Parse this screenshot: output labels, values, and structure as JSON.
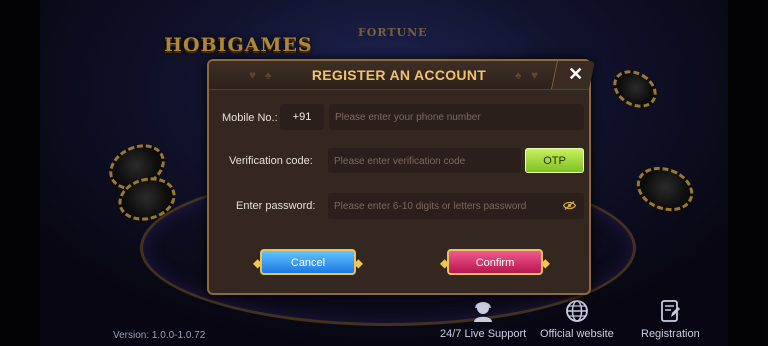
{
  "background": {
    "logo_text": "HOBIGAMES",
    "fortune_text": "FORTUNE"
  },
  "dialog": {
    "title": "REGISTER AN ACCOUNT",
    "close_glyph": "✕",
    "mobile": {
      "label": "Mobile  No.:",
      "country_code": "+91",
      "placeholder": "Please enter your phone number"
    },
    "verification": {
      "label": "Verification  code:",
      "placeholder": "Please enter verification code",
      "otp_label": "OTP"
    },
    "password": {
      "label": "Enter password:",
      "placeholder": "Please enter 6-10 digits or letters password",
      "toggle_icon": "eye-slash-icon"
    },
    "cancel_label": "Cancel",
    "confirm_label": "Confirm"
  },
  "footer": {
    "version": "Version: 1.0.0-1.0.72",
    "items": [
      {
        "label": "24/7 Live Support",
        "icon": "support-agent-icon"
      },
      {
        "label": "Official website",
        "icon": "globe-icon"
      },
      {
        "label": "Registration",
        "icon": "registration-form-icon"
      }
    ]
  },
  "colors": {
    "title": "#efc36e",
    "otp": "#a4dd3c",
    "cancel": "#2f8fe8",
    "confirm": "#d6306a",
    "dialog_bg": "#33271f",
    "dialog_border": "#8c6a3c"
  }
}
